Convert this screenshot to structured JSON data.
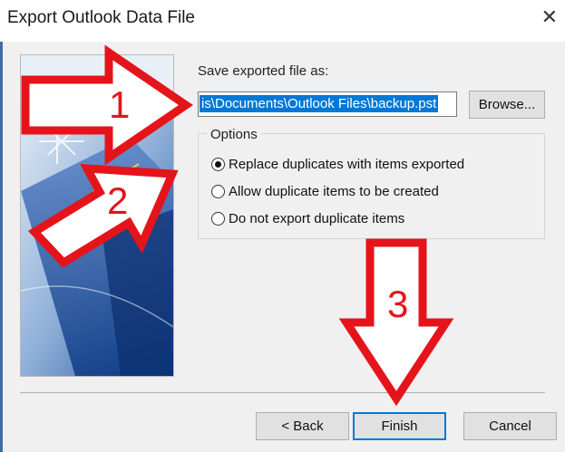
{
  "dialog": {
    "title": "Export Outlook Data File",
    "close_glyph": "✕"
  },
  "save": {
    "label": "Save exported file as:",
    "path_value": "is\\Documents\\Outlook Files\\backup.pst",
    "browse_label": "Browse..."
  },
  "options": {
    "legend": "Options",
    "selected_index": 0,
    "items": [
      {
        "label": "Replace duplicates with items exported",
        "checked": true
      },
      {
        "label": "Allow duplicate items to be created",
        "checked": false
      },
      {
        "label": "Do not export duplicate items",
        "checked": false
      }
    ]
  },
  "footer": {
    "back_label": "< Back",
    "finish_label": "Finish",
    "cancel_label": "Cancel"
  },
  "annotations": {
    "step1": "1",
    "step2": "2",
    "step3": "3",
    "arrow_color": "#e5141b"
  },
  "colors": {
    "selection": "#0078d7",
    "window_bg": "#f0f0f0"
  }
}
